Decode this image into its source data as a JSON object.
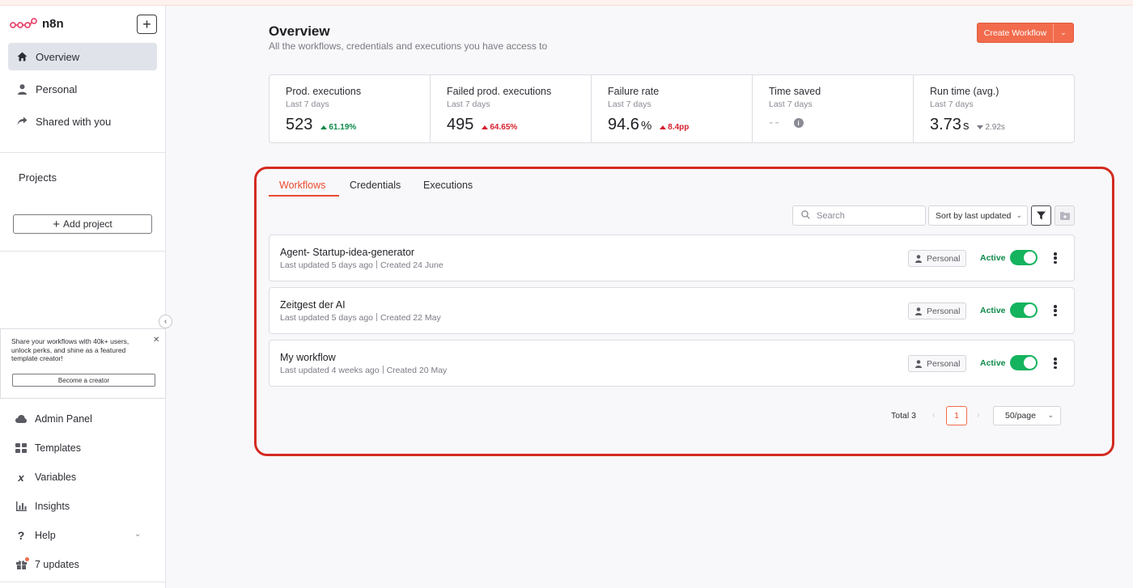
{
  "app": {
    "name": "n8n"
  },
  "sidebar": {
    "nav": [
      {
        "label": "Overview",
        "icon": "home-icon"
      },
      {
        "label": "Personal",
        "icon": "user-icon"
      },
      {
        "label": "Shared with you",
        "icon": "share-icon"
      }
    ],
    "projects_title": "Projects",
    "add_project_label": "Add project",
    "promo": {
      "text": "Share your workflows with 40k+ users, unlock perks, and shine as a featured template creator!",
      "button_label": "Become a creator"
    },
    "bottom": [
      {
        "label": "Admin Panel",
        "icon": "cloud-icon"
      },
      {
        "label": "Templates",
        "icon": "templates-icon"
      },
      {
        "label": "Variables",
        "icon": "variables-icon"
      },
      {
        "label": "Insights",
        "icon": "insights-icon"
      },
      {
        "label": "Help",
        "icon": "help-icon"
      },
      {
        "label": "7 updates",
        "icon": "gift-icon"
      }
    ]
  },
  "header": {
    "title": "Overview",
    "subtitle": "All the workflows, credentials and executions you have access to",
    "create_label": "Create Workflow"
  },
  "stats": [
    {
      "label": "Prod. executions",
      "period": "Last 7 days",
      "value": "523",
      "unit": "",
      "delta": "61.19%",
      "trend": "up",
      "trend_color": "#0e8a4a"
    },
    {
      "label": "Failed prod. executions",
      "period": "Last 7 days",
      "value": "495",
      "unit": "",
      "delta": "64.65%",
      "trend": "up",
      "trend_color": "#d61f2c"
    },
    {
      "label": "Failure rate",
      "period": "Last 7 days",
      "value": "94.6",
      "unit": "%",
      "delta": "8.4pp",
      "trend": "up",
      "trend_color": "#d61f2c"
    },
    {
      "label": "Time saved",
      "period": "Last 7 days",
      "value": "--",
      "unit": "",
      "delta": "",
      "trend": "none"
    },
    {
      "label": "Run time (avg.)",
      "period": "Last 7 days",
      "value": "3.73",
      "unit": "s",
      "delta": "2.92s",
      "trend": "down",
      "trend_color": "#7a7b85"
    }
  ],
  "tabs": [
    {
      "label": "Workflows",
      "active": true
    },
    {
      "label": "Credentials",
      "active": false
    },
    {
      "label": "Executions",
      "active": false
    }
  ],
  "toolbar": {
    "search_placeholder": "Search",
    "sort_label": "Sort by last updated"
  },
  "workflows": [
    {
      "name": "Agent- Startup-idea-generator",
      "updated": "Last updated 5 days ago",
      "created": "Created 24 June",
      "owner": "Personal",
      "status": "Active"
    },
    {
      "name": "Zeitgest der AI",
      "updated": "Last updated 5 days ago",
      "created": "Created 22 May",
      "owner": "Personal",
      "status": "Active"
    },
    {
      "name": "My workflow",
      "updated": "Last updated 4 weeks ago",
      "created": "Created 20 May",
      "owner": "Personal",
      "status": "Active"
    }
  ],
  "pagination": {
    "total_label": "Total 3",
    "current_page": "1",
    "page_size": "50/page"
  },
  "colors": {
    "accent": "#ea4b2e",
    "active_green": "#14b35e",
    "highlight_border": "#d42a20"
  }
}
